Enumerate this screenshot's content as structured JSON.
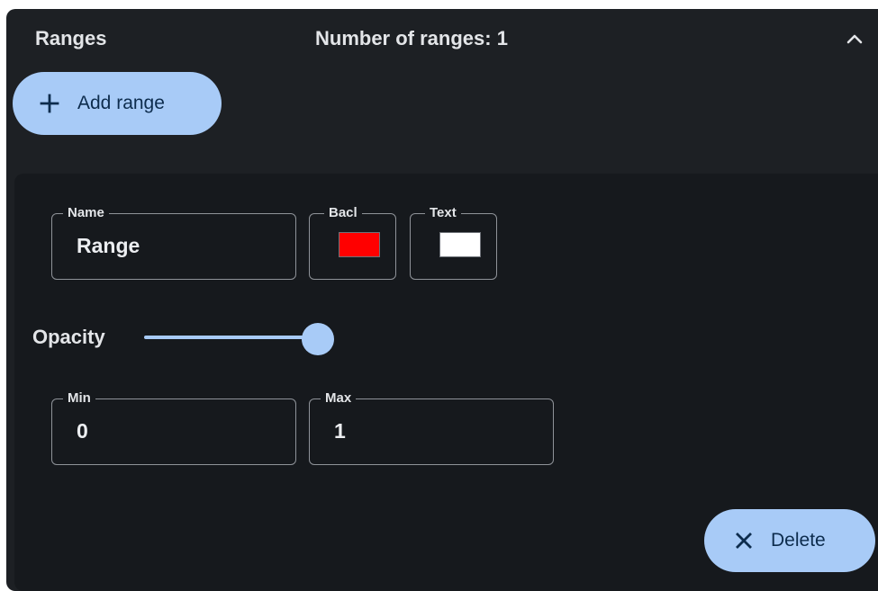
{
  "header": {
    "title": "Ranges",
    "count_text": "Number of ranges: 1",
    "collapse_icon": "chevron-up-icon"
  },
  "toolbar": {
    "add_label": "Add range",
    "add_icon": "plus-icon"
  },
  "range": {
    "name": {
      "label": "Name",
      "value": "Range"
    },
    "background": {
      "label": "Bacl",
      "color": "#ff0000"
    },
    "text_color": {
      "label": "Text",
      "color": "#ffffff"
    },
    "opacity": {
      "label": "Opacity",
      "value": 1
    },
    "min": {
      "label": "Min",
      "value": "0"
    },
    "max": {
      "label": "Max",
      "value": "1"
    },
    "delete_label": "Delete",
    "delete_icon": "close-icon"
  },
  "colors": {
    "accent": "#a8cbf7",
    "panel": "#1d2024",
    "card": "#16191d"
  }
}
